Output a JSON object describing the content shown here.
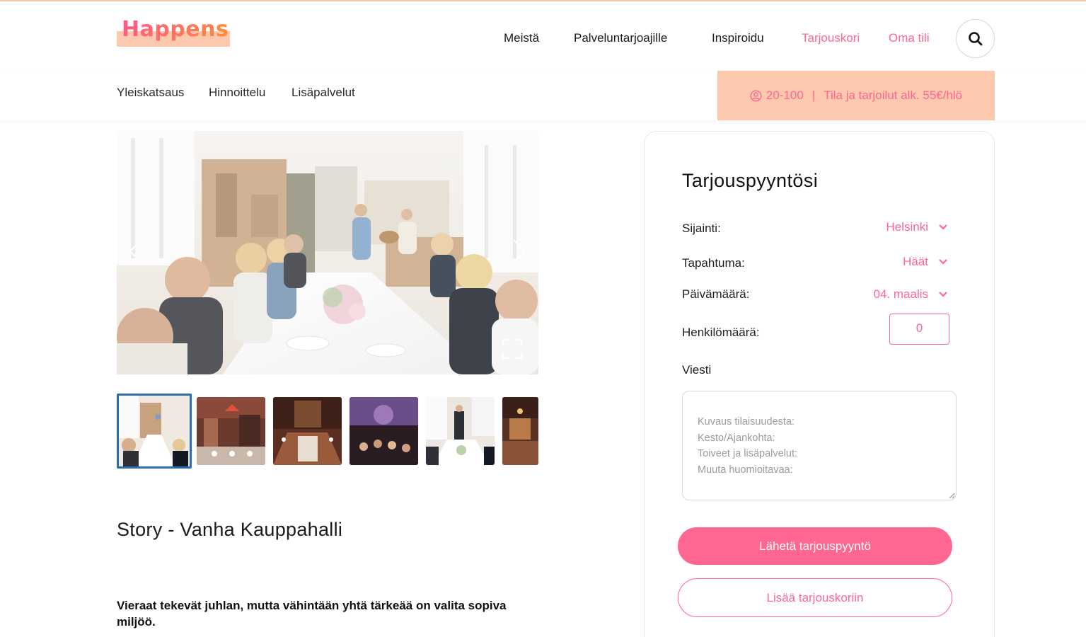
{
  "header": {
    "logo_text": "Happens",
    "nav": [
      {
        "label": "Meistä",
        "accent": false
      },
      {
        "label": "Palveluntarjoajille",
        "accent": false
      },
      {
        "label": "Inspiroidu",
        "accent": false
      },
      {
        "label": "Tarjouskori",
        "accent": true
      },
      {
        "label": "Oma tili",
        "accent": true
      }
    ],
    "search_icon": "search-icon"
  },
  "subnav": {
    "items": [
      "Yleiskatsaus",
      "Hinnoittelu",
      "Lisäpalvelut"
    ],
    "info": {
      "icon": "person-circle-icon",
      "capacity": "20-100",
      "separator": "|",
      "price_text": "Tila ja tarjoilut alk. 55€/hlö"
    }
  },
  "gallery": {
    "prev_icon": "chevron-left-icon",
    "next_icon": "chevron-right-icon",
    "fullscreen_icon": "fullscreen-icon",
    "thumbnail_count": 6,
    "active_thumbnail": 0
  },
  "venue": {
    "title": "Story - Vanha Kauppahalli",
    "lead": "Vieraat tekevät juhlan, mutta vähintään yhtä tärkeää on valita sopiva miljöö."
  },
  "quote_form": {
    "title": "Tarjouspyyntösi",
    "location": {
      "label": "Sijainti:",
      "value": "Helsinki"
    },
    "event": {
      "label": "Tapahtuma:",
      "value": "Häät"
    },
    "date": {
      "label": "Päivämäärä:",
      "value": "04. maalis"
    },
    "guests": {
      "label": "Henkilömäärä:",
      "value": "0"
    },
    "message": {
      "label": "Viesti",
      "placeholder": "Kuvaus tilaisuudesta:\nKesto/Ajankohta:\nToiveet ja lisäpalvelut:\nMuuta huomioitavaa:"
    },
    "submit_label": "Lähetä tarjouspyyntö",
    "add_to_cart_label": "Lisää tarjouskoriin"
  },
  "colors": {
    "accent": "#ff6690",
    "accent_soft": "#fcc9ae",
    "thumb_active_border": "#2d6db2"
  }
}
